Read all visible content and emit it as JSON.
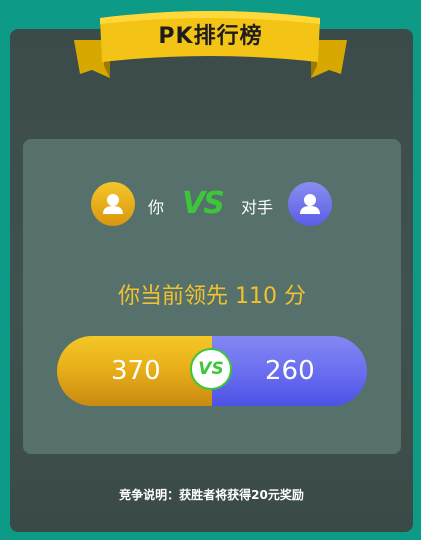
{
  "header": {
    "title": "PK排行榜"
  },
  "players": {
    "me": {
      "name": "你",
      "score": "370",
      "avatar_icon": "user-icon",
      "color": "#f2b51f"
    },
    "opponent": {
      "name": "对手",
      "score": "260",
      "avatar_icon": "user-icon",
      "color": "#6b6ff0"
    }
  },
  "vs_label": "VS",
  "status": {
    "lead_text": "你当前领先 110 分"
  },
  "footer": {
    "description": "竞争说明：获胜者将获得20元奖励"
  },
  "progress": {
    "me_fraction": 0.5
  },
  "colors": {
    "accent_green": "#3cc63a",
    "gold": "#f2c12e",
    "background": "#0d9a86"
  }
}
